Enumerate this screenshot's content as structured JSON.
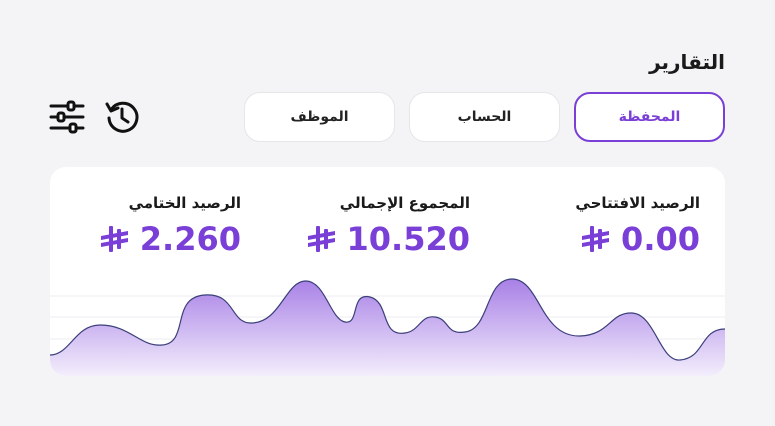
{
  "page": {
    "title": "التقارير"
  },
  "tabs": [
    {
      "label": "المحفظة",
      "active": true
    },
    {
      "label": "الحساب",
      "active": false
    },
    {
      "label": "الموظف",
      "active": false
    }
  ],
  "toolbar": {
    "history_icon": "history-icon",
    "filter_icon": "sliders-icon"
  },
  "stats": [
    {
      "label": "الرصيد الافتتاحي",
      "value": "0.00",
      "currency_icon": "saudi-riyal-icon"
    },
    {
      "label": "المجموع الإجمالي",
      "value": "10.520",
      "currency_icon": "saudi-riyal-icon"
    },
    {
      "label": "الرصيد الختامي",
      "value": "2.260",
      "currency_icon": "saudi-riyal-icon"
    }
  ],
  "colors": {
    "accent": "#7a3fd6",
    "chart_fill_top": "#a880e6",
    "chart_fill_bottom": "#f3eefc",
    "chart_line": "#3b3f7a"
  }
}
